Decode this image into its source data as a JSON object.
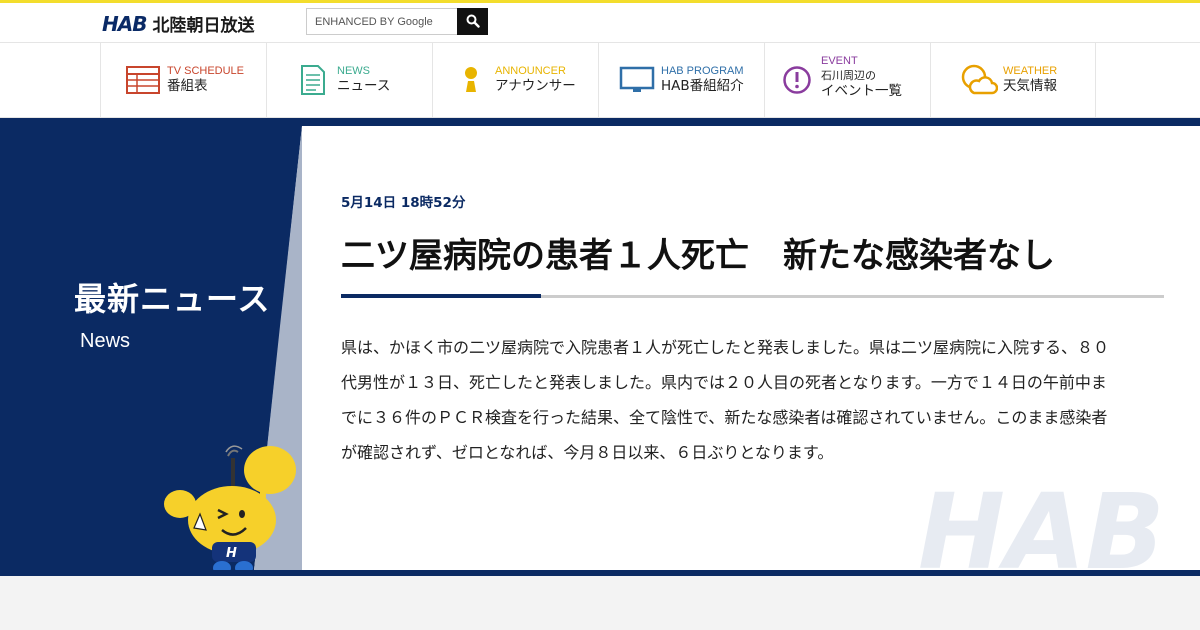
{
  "header": {
    "logo_mark": "HAB",
    "logo_text": "北陸朝日放送",
    "search_placeholder": "ENHANCED BY Google",
    "search_icon": "magnifier-icon"
  },
  "nav": {
    "items": [
      {
        "en": "TV SCHEDULE",
        "jp": "番組表",
        "icon": "tv-schedule-grid-icon",
        "color": "#c8452c"
      },
      {
        "en": "NEWS",
        "jp": "ニュース",
        "icon": "document-icon",
        "color": "#3bab8f"
      },
      {
        "en": "ANNOUNCER",
        "jp": "アナウンサー",
        "icon": "person-icon",
        "color": "#e8b400"
      },
      {
        "en": "HAB PROGRAM",
        "jp": "HAB番組紹介",
        "icon": "monitor-icon",
        "color": "#2f6fa8"
      },
      {
        "en": "EVENT",
        "jp_line1": "石川周辺の",
        "jp": "イベント一覧",
        "icon": "exclamation-circle-icon",
        "color": "#8a3c9e"
      },
      {
        "en": "WEATHER",
        "jp": "天気情報",
        "icon": "sun-cloud-icon",
        "color": "#e8a000"
      }
    ]
  },
  "side": {
    "title": "最新ニュース",
    "subtitle": "News"
  },
  "article": {
    "date": "5月14日 18時52分",
    "headline": "二ツ屋病院の患者１人死亡　新たな感染者なし",
    "body": "県は、かほく市の二ツ屋病院で入院患者１人が死亡したと発表しました。県は二ツ屋病院に入院する、８０代男性が１３日、死亡したと発表しました。県内では２０人目の死者となります。一方で１４日の午前中までに３６件のＰＣＲ検査を行った結果、全て陰性で、新たな感染者は確認されていません。このまま感染者が確認されず、ゼロとなれば、今月８日以来、６日ぶりとなります。"
  },
  "watermark_text": "HAB",
  "colors": {
    "brand_navy": "#0b2a63",
    "accent_yellow": "#f3dd2c"
  }
}
